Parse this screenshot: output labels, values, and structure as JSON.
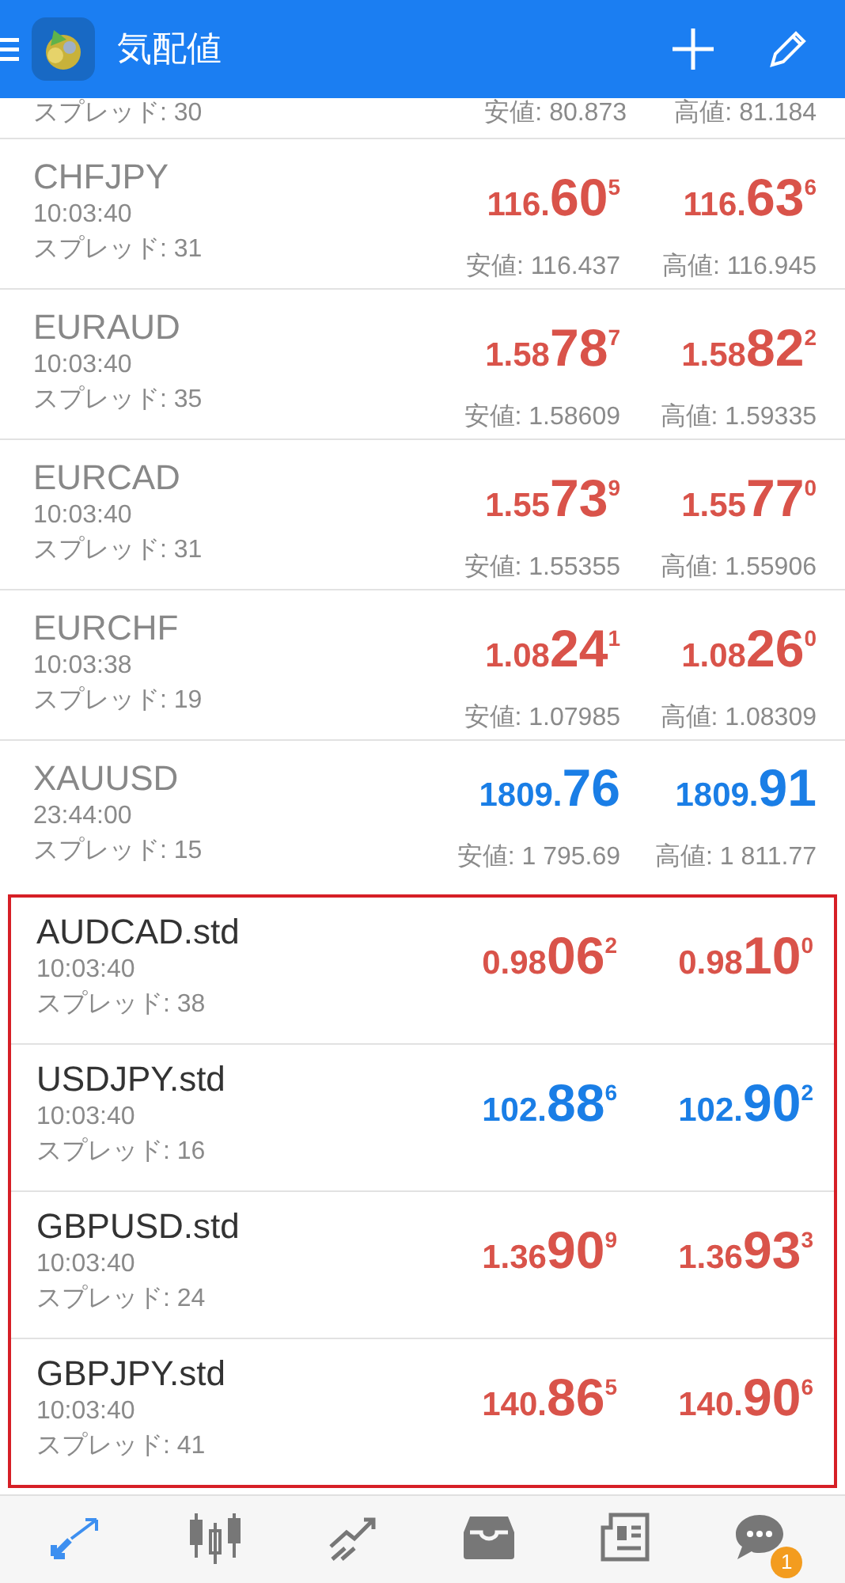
{
  "header": {
    "title": "気配値"
  },
  "partial_row": {
    "spread": "スプレッド: 30",
    "low": "安値: 80.873",
    "high": "高値: 81.184"
  },
  "quotes": [
    {
      "symbol": "CHFJPY",
      "time": "10:03:40",
      "spread": "スプレッド: 31",
      "color": "#d9534a",
      "bid": {
        "pre": "116.",
        "big": "60",
        "sup": "5"
      },
      "ask": {
        "pre": "116.",
        "big": "63",
        "sup": "6"
      },
      "low": "安値: 116.437",
      "high": "高値: 116.945"
    },
    {
      "symbol": "EURAUD",
      "time": "10:03:40",
      "spread": "スプレッド: 35",
      "color": "#d9534a",
      "bid": {
        "pre": "1.58",
        "big": "78",
        "sup": "7"
      },
      "ask": {
        "pre": "1.58",
        "big": "82",
        "sup": "2"
      },
      "low": "安値: 1.58609",
      "high": "高値: 1.59335"
    },
    {
      "symbol": "EURCAD",
      "time": "10:03:40",
      "spread": "スプレッド: 31",
      "color": "#d9534a",
      "bid": {
        "pre": "1.55",
        "big": "73",
        "sup": "9"
      },
      "ask": {
        "pre": "1.55",
        "big": "77",
        "sup": "0"
      },
      "low": "安値: 1.55355",
      "high": "高値: 1.55906"
    },
    {
      "symbol": "EURCHF",
      "time": "10:03:38",
      "spread": "スプレッド: 19",
      "color": "#d9534a",
      "bid": {
        "pre": "1.08",
        "big": "24",
        "sup": "1"
      },
      "ask": {
        "pre": "1.08",
        "big": "26",
        "sup": "0"
      },
      "low": "安値: 1.07985",
      "high": "高値: 1.08309"
    },
    {
      "symbol": "XAUUSD",
      "time": "23:44:00",
      "spread": "スプレッド: 15",
      "color": "#1a7ee6",
      "bid": {
        "pre": "1809.",
        "big": "76"
      },
      "ask": {
        "pre": "1809.",
        "big": "91"
      },
      "low": "安値: 1 795.69",
      "high": "高値: 1 811.77"
    }
  ],
  "highlighted_quotes": [
    {
      "symbol": "AUDCAD.std",
      "time": "10:03:40",
      "spread": "スプレッド: 38",
      "color": "#d9534a",
      "bid": {
        "pre": "0.98",
        "big": "06",
        "sup": "2"
      },
      "ask": {
        "pre": "0.98",
        "big": "10",
        "sup": "0"
      }
    },
    {
      "symbol": "USDJPY.std",
      "time": "10:03:40",
      "spread": "スプレッド: 16",
      "color": "#1a7ee6",
      "bid": {
        "pre": "102.",
        "big": "88",
        "sup": "6"
      },
      "ask": {
        "pre": "102.",
        "big": "90",
        "sup": "2"
      }
    },
    {
      "symbol": "GBPUSD.std",
      "time": "10:03:40",
      "spread": "スプレッド: 24",
      "color": "#d9534a",
      "bid": {
        "pre": "1.36",
        "big": "90",
        "sup": "9"
      },
      "ask": {
        "pre": "1.36",
        "big": "93",
        "sup": "3"
      }
    },
    {
      "symbol": "GBPJPY.std",
      "time": "10:03:40",
      "spread": "スプレッド: 41",
      "color": "#d9534a",
      "bid": {
        "pre": "140.",
        "big": "86",
        "sup": "5"
      },
      "ask": {
        "pre": "140.",
        "big": "90",
        "sup": "6"
      }
    }
  ],
  "nav": [
    {
      "kind": "quotes",
      "selected": true
    },
    {
      "kind": "chart",
      "selected": false
    },
    {
      "kind": "trade",
      "selected": false
    },
    {
      "kind": "history",
      "selected": false
    },
    {
      "kind": "news",
      "selected": false
    },
    {
      "kind": "messages",
      "selected": false,
      "badge": "1"
    }
  ]
}
